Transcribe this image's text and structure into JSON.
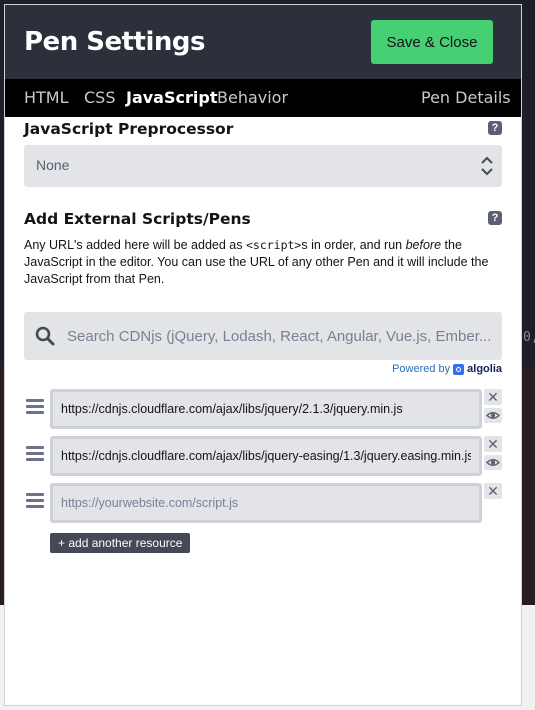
{
  "modal": {
    "title": "Pen Settings",
    "save_label": "Save & Close"
  },
  "tabs": [
    {
      "label": "HTML",
      "active": false
    },
    {
      "label": "CSS",
      "active": false
    },
    {
      "label": "JavaScript",
      "active": true
    },
    {
      "label": "Behavior",
      "active": false
    },
    {
      "label": "Pen Details",
      "active": false
    }
  ],
  "preprocessor": {
    "heading": "JavaScript Preprocessor",
    "help": "?",
    "selected": "None"
  },
  "external": {
    "heading": "Add External Scripts/Pens",
    "help": "?",
    "desc_1": "Any URL's added here will be added as ",
    "desc_code": "<script>",
    "desc_2": "s in order, and run ",
    "desc_em": "before",
    "desc_3": " the JavaScript in the editor. You can use the URL of any other Pen and it will include the JavaScript from that Pen.",
    "search_placeholder": "Search CDNjs (jQuery, Lodash, React, Angular, Vue.js, Ember...)",
    "powered_by": "Powered by",
    "algolia": "algolia",
    "resources": [
      {
        "value": "https://cdnjs.cloudflare.com/ajax/libs/jquery/2.1.3/jquery.min.js",
        "placeholder": ""
      },
      {
        "value": "https://cdnjs.cloudflare.com/ajax/libs/jquery-easing/1.3/jquery.easing.min.js",
        "placeholder": ""
      },
      {
        "value": "",
        "placeholder": "https://yourwebsite.com/script.js"
      }
    ],
    "close_glyph": "✕",
    "add_label": "+ add another resource"
  },
  "background": {
    "code_fragment": "0,"
  },
  "colors": {
    "header": "#2c303a",
    "tabbar": "#000000",
    "save_button": "#47cf73",
    "field": "#e3e4e8"
  }
}
